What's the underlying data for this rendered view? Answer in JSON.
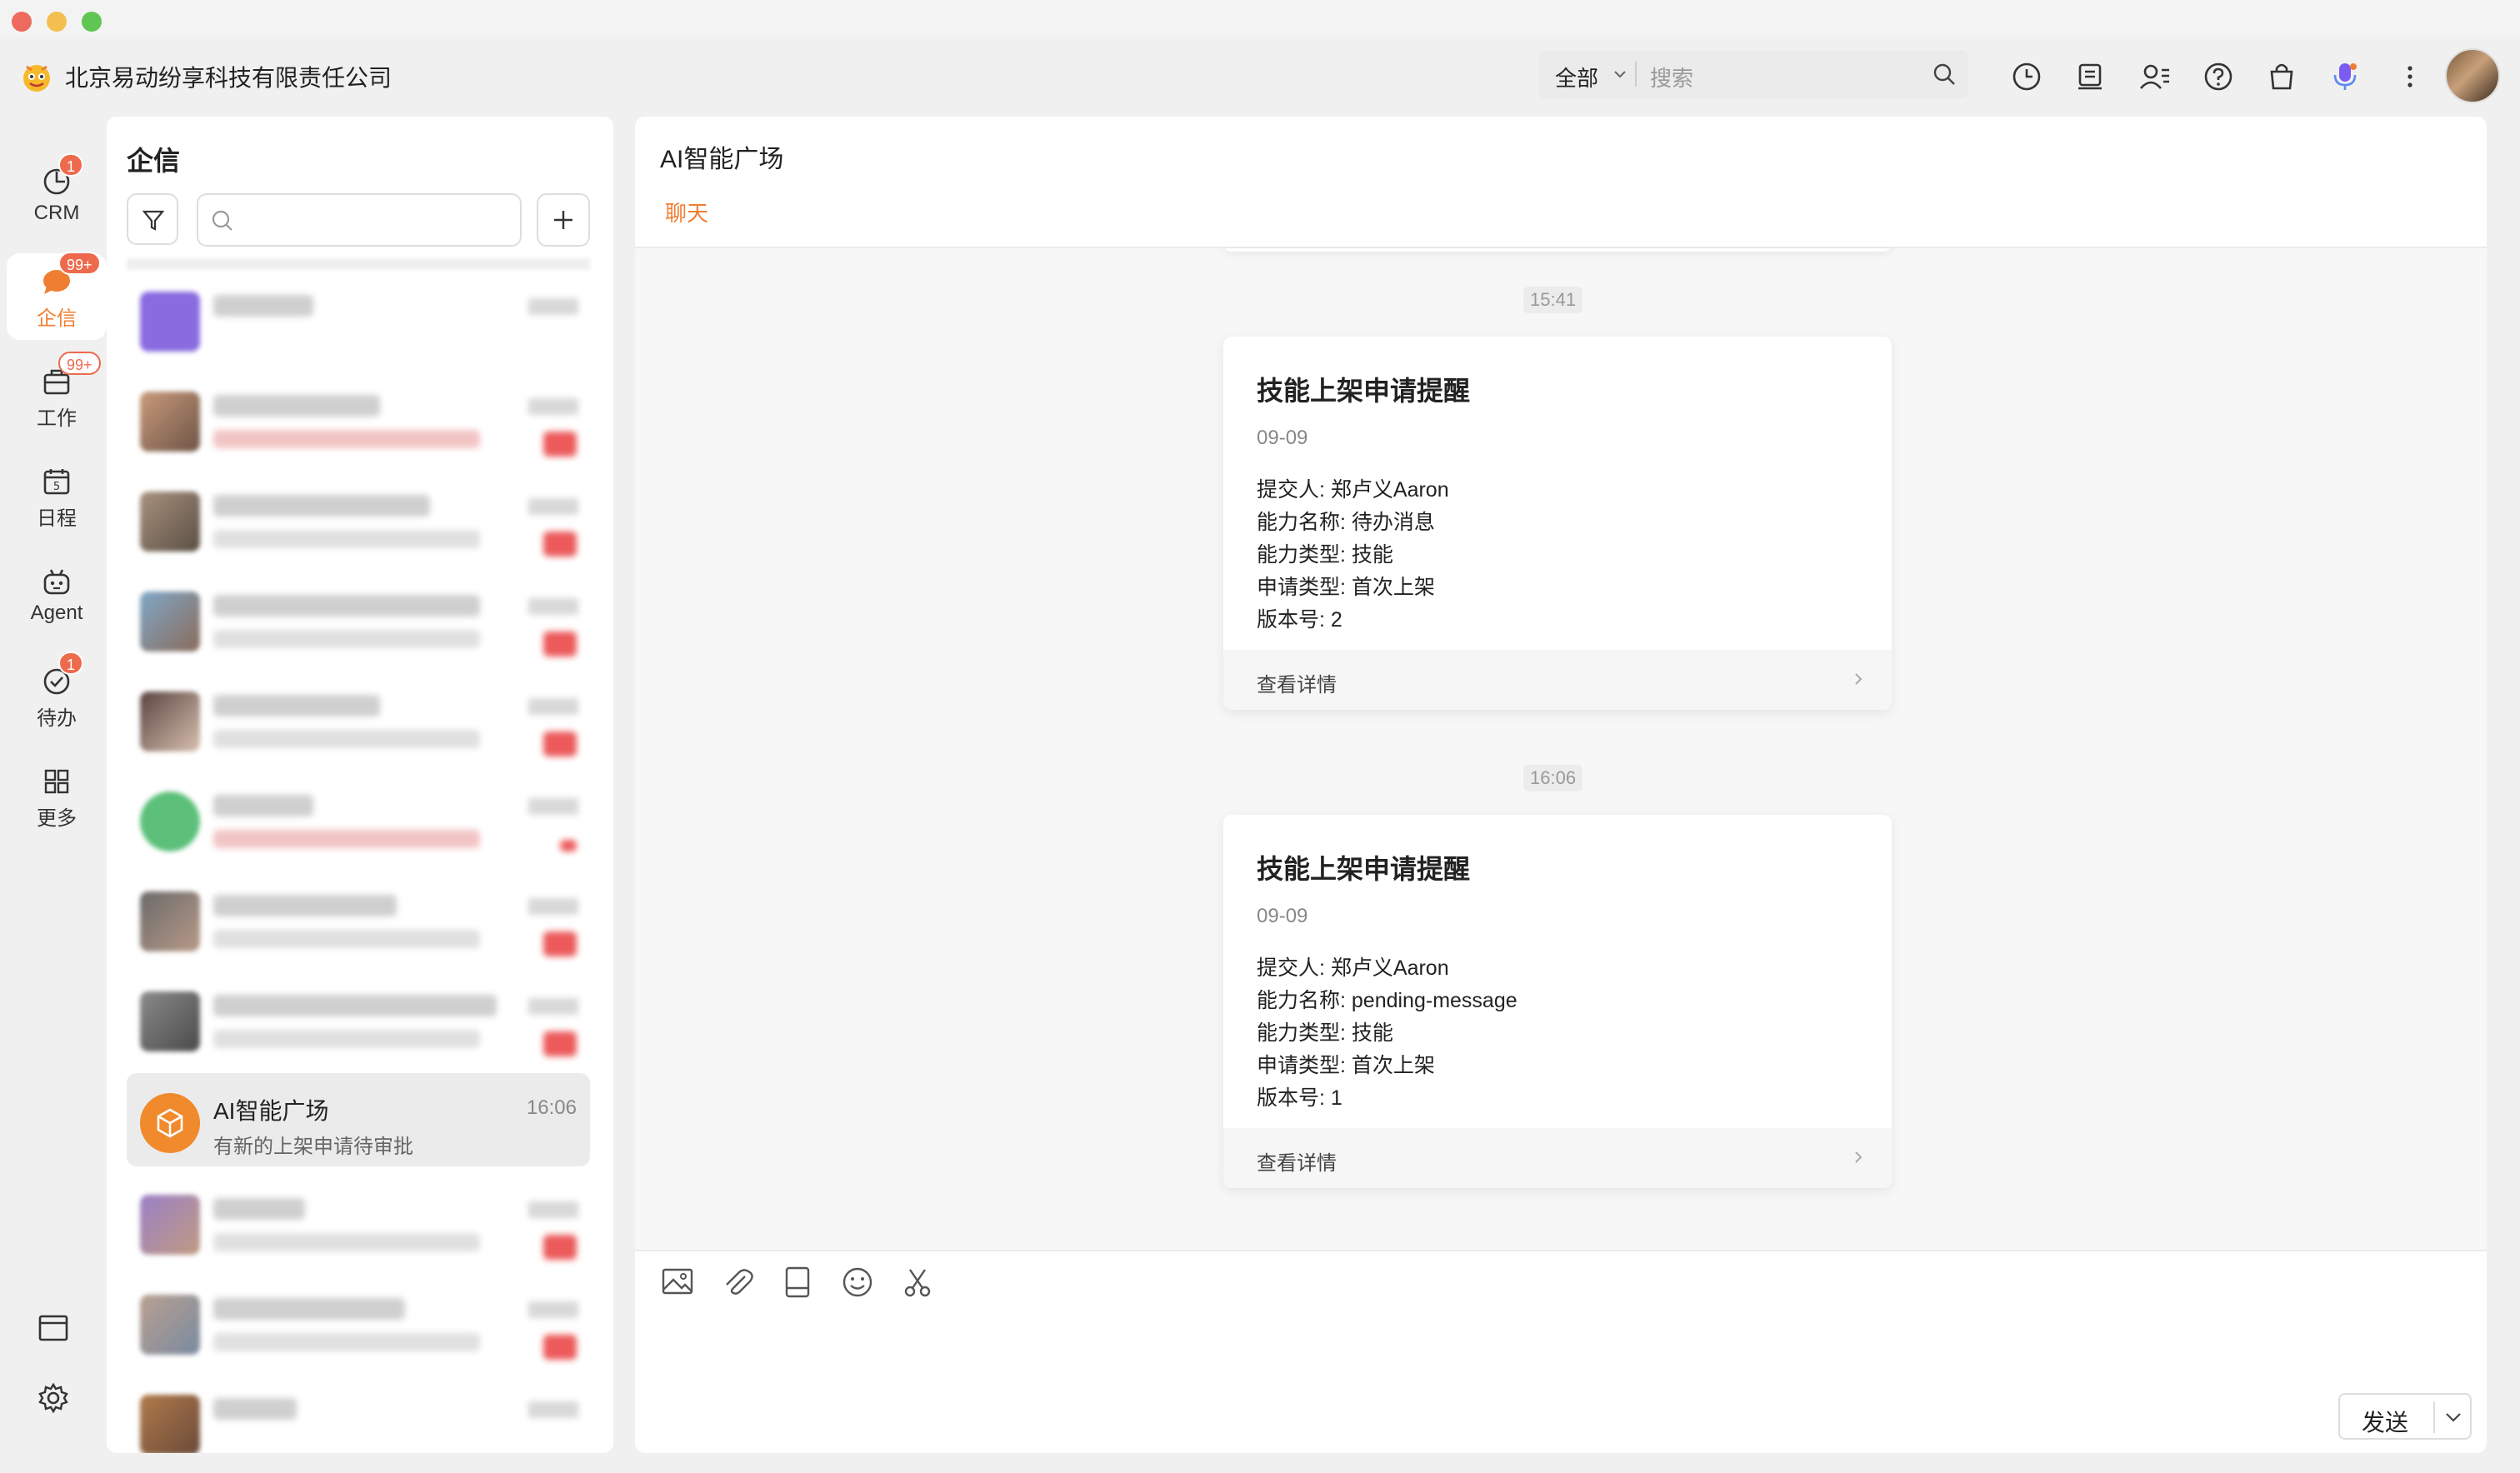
{
  "app": {
    "company": "北京易动纷享科技有限责任公司"
  },
  "search": {
    "scope": "全部",
    "placeholder": "搜索"
  },
  "colors": {
    "accent": "#f07e32",
    "badge": "#ee6a4d"
  },
  "nav": {
    "items": [
      {
        "label": "CRM",
        "icon": "clock-icon",
        "badge": "1"
      },
      {
        "label": "企信",
        "icon": "chat-bubble-icon",
        "badge": "99+"
      },
      {
        "label": "工作",
        "icon": "briefcase-icon",
        "badge": "99+"
      },
      {
        "label": "日程",
        "icon": "calendar-icon",
        "badge": ""
      },
      {
        "label": "Agent",
        "icon": "robot-icon",
        "badge": ""
      },
      {
        "label": "待办",
        "icon": "check-circle-icon",
        "badge": "1"
      },
      {
        "label": "更多",
        "icon": "grid-icon",
        "badge": ""
      }
    ]
  },
  "list": {
    "title": "企信",
    "active": {
      "name": "AI智能广场",
      "preview": "有新的上架申请待审批",
      "time": "16:06"
    }
  },
  "chat": {
    "title": "AI智能广场",
    "tab": "聊天",
    "messages": [
      {
        "time": "15:41",
        "title": "技能上架申请提醒",
        "date": "09-09",
        "rows": [
          "提交人: 郑卢义Aaron",
          "能力名称: 待办消息",
          "能力类型: 技能",
          "申请类型: 首次上架",
          "版本号: 2"
        ],
        "link": "查看详情"
      },
      {
        "time": "16:06",
        "title": "技能上架申请提醒",
        "date": "09-09",
        "rows": [
          "提交人: 郑卢义Aaron",
          "能力名称: pending-message",
          "能力类型: 技能",
          "申请类型: 首次上架",
          "版本号: 1"
        ],
        "link": "查看详情"
      }
    ],
    "send": "发送"
  }
}
